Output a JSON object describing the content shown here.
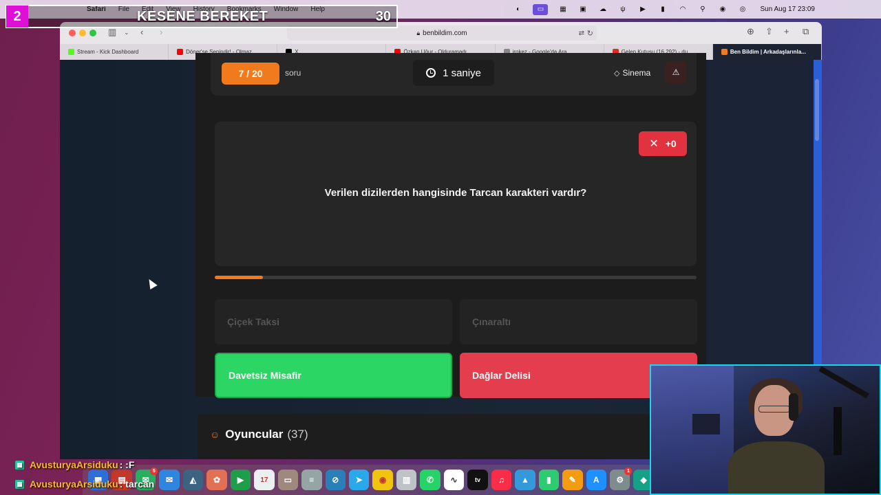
{
  "menubar": {
    "app": "Safari",
    "items": [
      "File",
      "Edit",
      "View",
      "History",
      "Bookmarks",
      "Window",
      "Help"
    ],
    "datetime": "Sun Aug 17  23:09"
  },
  "overlay": {
    "number": "2",
    "name": "KESENE BEREKET",
    "score": "30"
  },
  "browser": {
    "url": "benbildim.com",
    "tabs": [
      {
        "label": "Stream - Kick Dashboard",
        "color": "#53fc18"
      },
      {
        "label": "Döner'se Senindir! - Olmaz...",
        "color": "#ff0000"
      },
      {
        "label": "X",
        "color": "#000000"
      },
      {
        "label": "Özkan Uğur - Olduramadı...",
        "color": "#ff0000"
      },
      {
        "label": "jrokez - Google'da Ara",
        "color": "#888888"
      },
      {
        "label": "Gelen Kutusu (16.292) - du...",
        "color": "#d93025"
      },
      {
        "label": "Ben Bildim | Arkadaşlarınla...",
        "color": "#f07a1c"
      }
    ],
    "active_tab": 6
  },
  "quiz": {
    "counter": "7 / 20",
    "counter_suffix": "soru",
    "timer": "1 saniye",
    "category": "Sinema",
    "report_icon": "warning-icon",
    "penalty": "+0",
    "question": "Verilen dizilerden hangisinde Tarcan karakteri vardır?",
    "progress": 0.1,
    "answers": [
      {
        "label": "Çiçek Taksi",
        "state": "dim"
      },
      {
        "label": "Çınaraltı",
        "state": "dim"
      },
      {
        "label": "Davetsiz Misafir",
        "state": "correct"
      },
      {
        "label": "Dağlar Delisi",
        "state": "wrong"
      }
    ],
    "accent_color": "#f07a1c"
  },
  "players": {
    "title": "Oyuncular",
    "count": "(37)"
  },
  "chat": [
    {
      "user": "AvusturyaArsiduku",
      "message": ": :F"
    },
    {
      "user": "AvusturyaArsiduku",
      "message": ": tarcan"
    }
  ]
}
